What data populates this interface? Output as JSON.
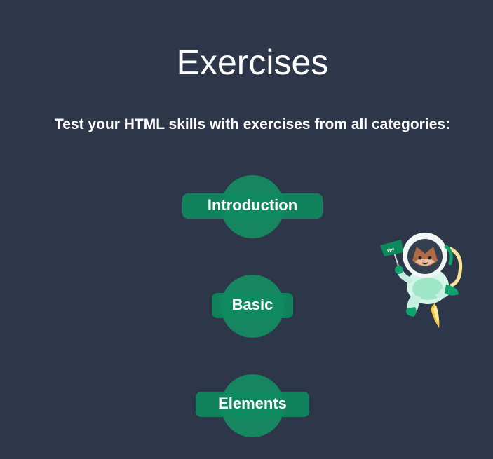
{
  "header": {
    "title": "Exercises",
    "subtitle": "Test your HTML skills with exercises from all categories:"
  },
  "exercises": [
    {
      "label": "Introduction"
    },
    {
      "label": "Basic"
    },
    {
      "label": "Elements"
    }
  ],
  "mascot": {
    "icon": "astronaut-mascot-icon",
    "flag_text": "w³"
  },
  "colors": {
    "background": "#2e3749",
    "accent_green": "#04aa6d",
    "circle_green": "#15865f",
    "text": "#ffffff"
  }
}
